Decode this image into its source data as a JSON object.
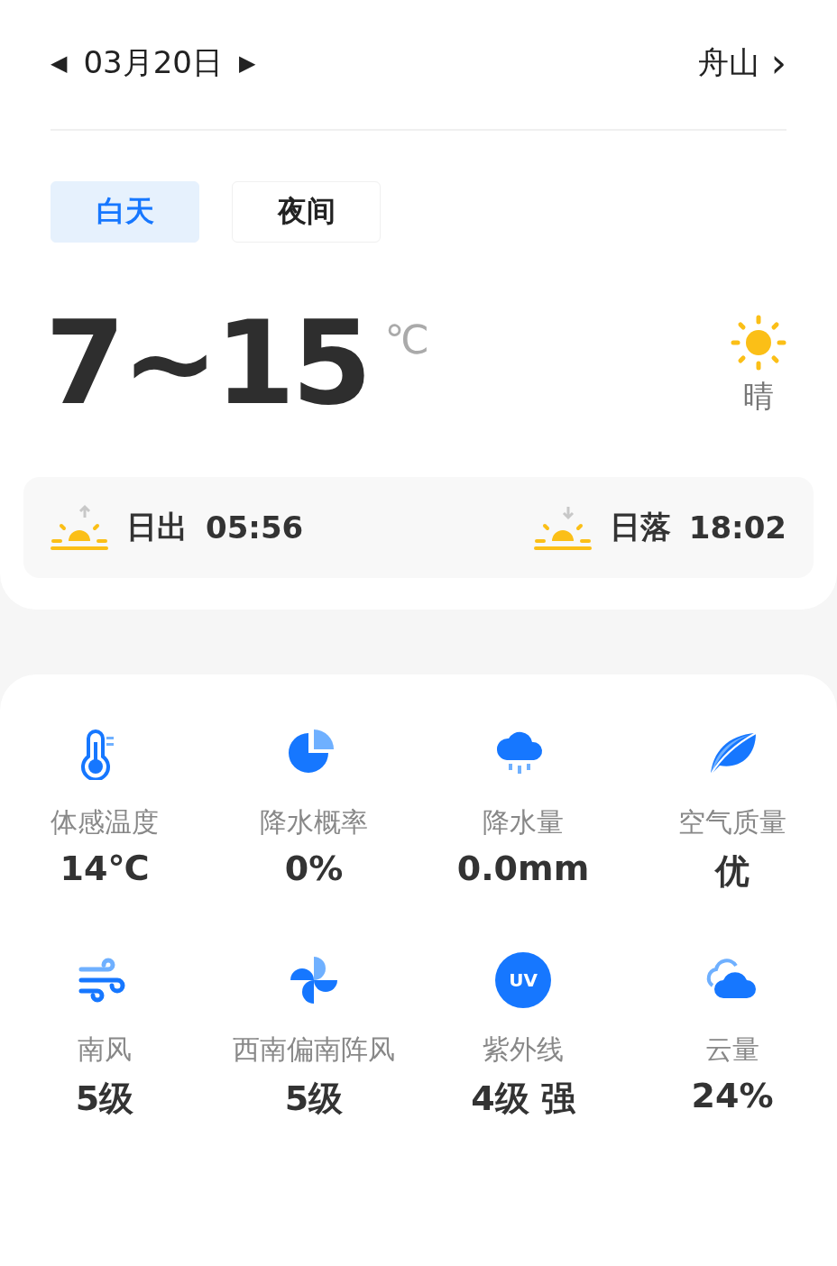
{
  "header": {
    "prev": "◀",
    "date": "03月20日",
    "next": "▶",
    "city": "舟山",
    "city_arrow": "›"
  },
  "tabs": [
    {
      "label": "白天",
      "selected": true
    },
    {
      "label": "夜间",
      "selected": false
    }
  ],
  "temperature": {
    "range": "7~15",
    "unit": "℃",
    "condition": "晴"
  },
  "sun": [
    {
      "kind": "sunrise",
      "label": "日出",
      "time": "05:56"
    },
    {
      "kind": "sunset",
      "label": "日落",
      "time": "18:02"
    }
  ],
  "details": [
    {
      "kind": "thermometer",
      "label": "体感温度",
      "value": "14℃"
    },
    {
      "kind": "pie",
      "label": "降水概率",
      "value": "0%"
    },
    {
      "kind": "rain",
      "label": "降水量",
      "value": "0.0mm"
    },
    {
      "kind": "leaf",
      "label": "空气质量",
      "value": "优"
    },
    {
      "kind": "wind",
      "label": "南风",
      "value": "5级"
    },
    {
      "kind": "pinwheel",
      "label": "西南偏南阵风",
      "value": "5级"
    },
    {
      "kind": "uv",
      "label": "紫外线",
      "value": "4级 强",
      "badge": "UV"
    },
    {
      "kind": "cloud",
      "label": "云量",
      "value": "24%"
    }
  ]
}
